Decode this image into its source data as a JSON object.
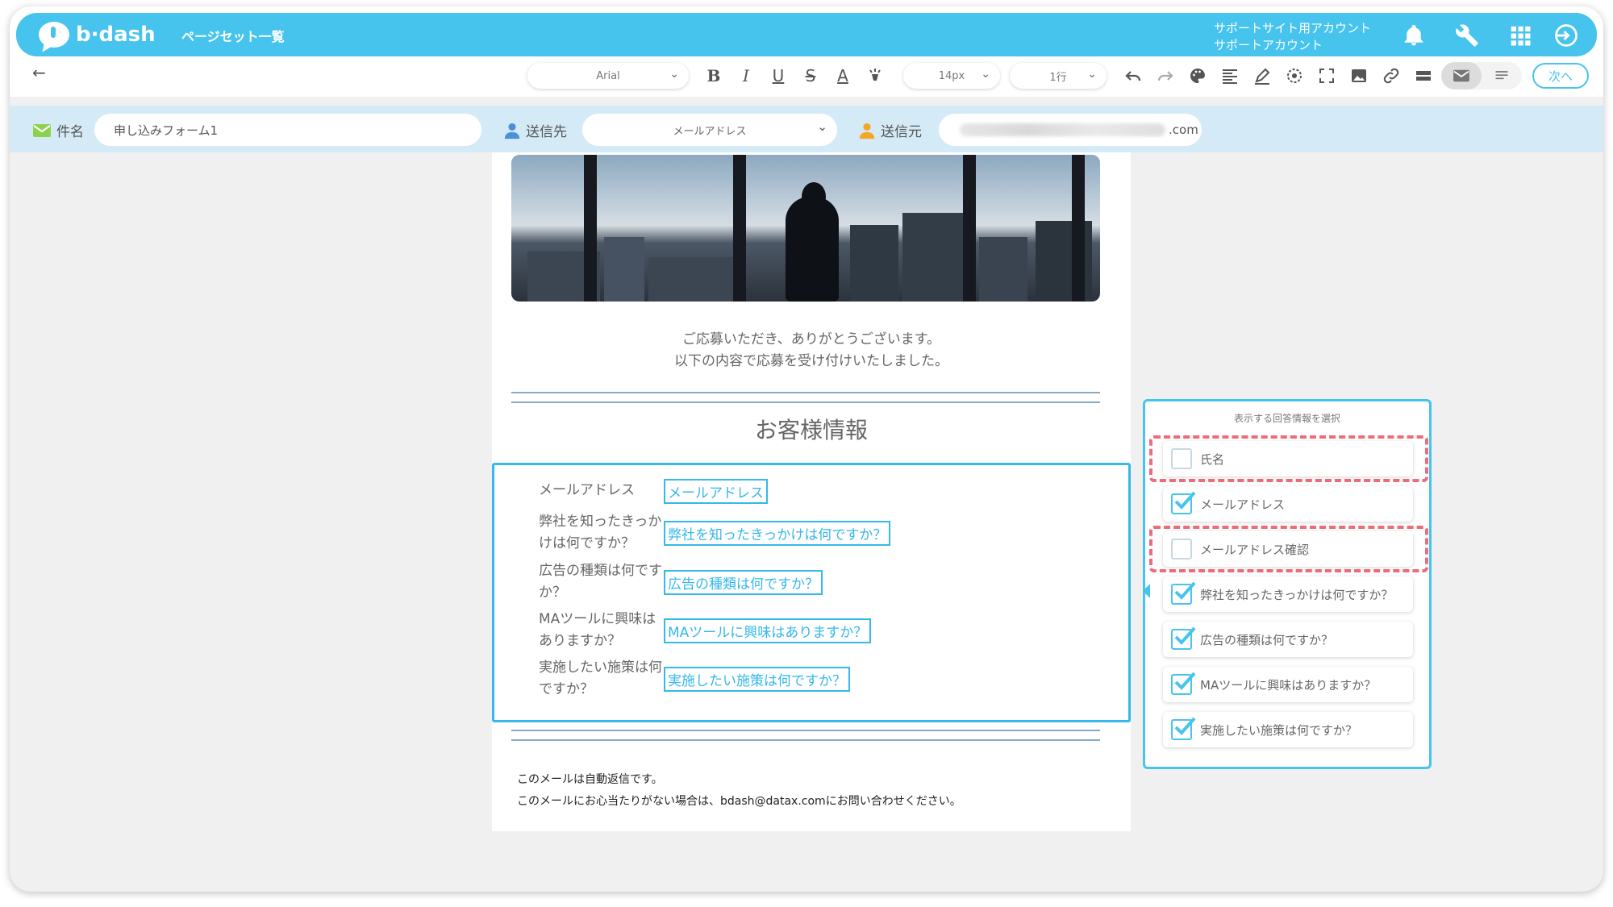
{
  "header": {
    "logo_text": "b·dash",
    "page_title": "ページセット一覧",
    "account_line1": "サポートサイト用アカウント",
    "account_line2": "サポートアカウント"
  },
  "toolbar": {
    "font": "Arial",
    "size": "14px",
    "line_height": "1行",
    "next_label": "次へ"
  },
  "meta": {
    "subject_label": "件名",
    "subject_value": "申し込みフォーム1",
    "to_label": "送信先",
    "to_value": "メールアドレス",
    "from_label": "送信元",
    "from_value_suffix": ".com"
  },
  "email": {
    "thanks_line1": "ご応募いただき、ありがとうございます。",
    "thanks_line2": "以下の内容で応募を受け付けいたしました。",
    "section_title": "お客様情報",
    "fields": [
      {
        "label": "メールアドレス",
        "value": "メールアドレス"
      },
      {
        "label": "弊社を知ったきっかけは何ですか？",
        "value": "弊社を知ったきっかけは何ですか？"
      },
      {
        "label": "広告の種類は何ですか？",
        "value": "広告の種類は何ですか？"
      },
      {
        "label": "MAツールに興味はありますか？",
        "value": "MAツールに興味はありますか？"
      },
      {
        "label": "実施したい施策は何ですか？",
        "value": "実施したい施策は何ですか？"
      }
    ],
    "footer_line1": "このメールは自動返信です。",
    "footer_line2": "このメールにお心当たりがない場合は、bdash@datax.comにお問い合わせください。"
  },
  "panel": {
    "title": "表示する回答情報を選択",
    "options": [
      {
        "label": "氏名",
        "checked": false
      },
      {
        "label": "メールアドレス",
        "checked": true
      },
      {
        "label": "メールアドレス確認",
        "checked": false
      },
      {
        "label": "弊社を知ったきっかけは何ですか？",
        "checked": true
      },
      {
        "label": "広告の種類は何ですか？",
        "checked": true
      },
      {
        "label": "MAツールに興味はありますか？",
        "checked": true
      },
      {
        "label": "実施したい施策は何ですか？",
        "checked": true
      }
    ]
  },
  "colors": {
    "accent": "#47c4ee",
    "highlight": "#ee6c7a",
    "meta_bg": "#d4eaf7"
  }
}
